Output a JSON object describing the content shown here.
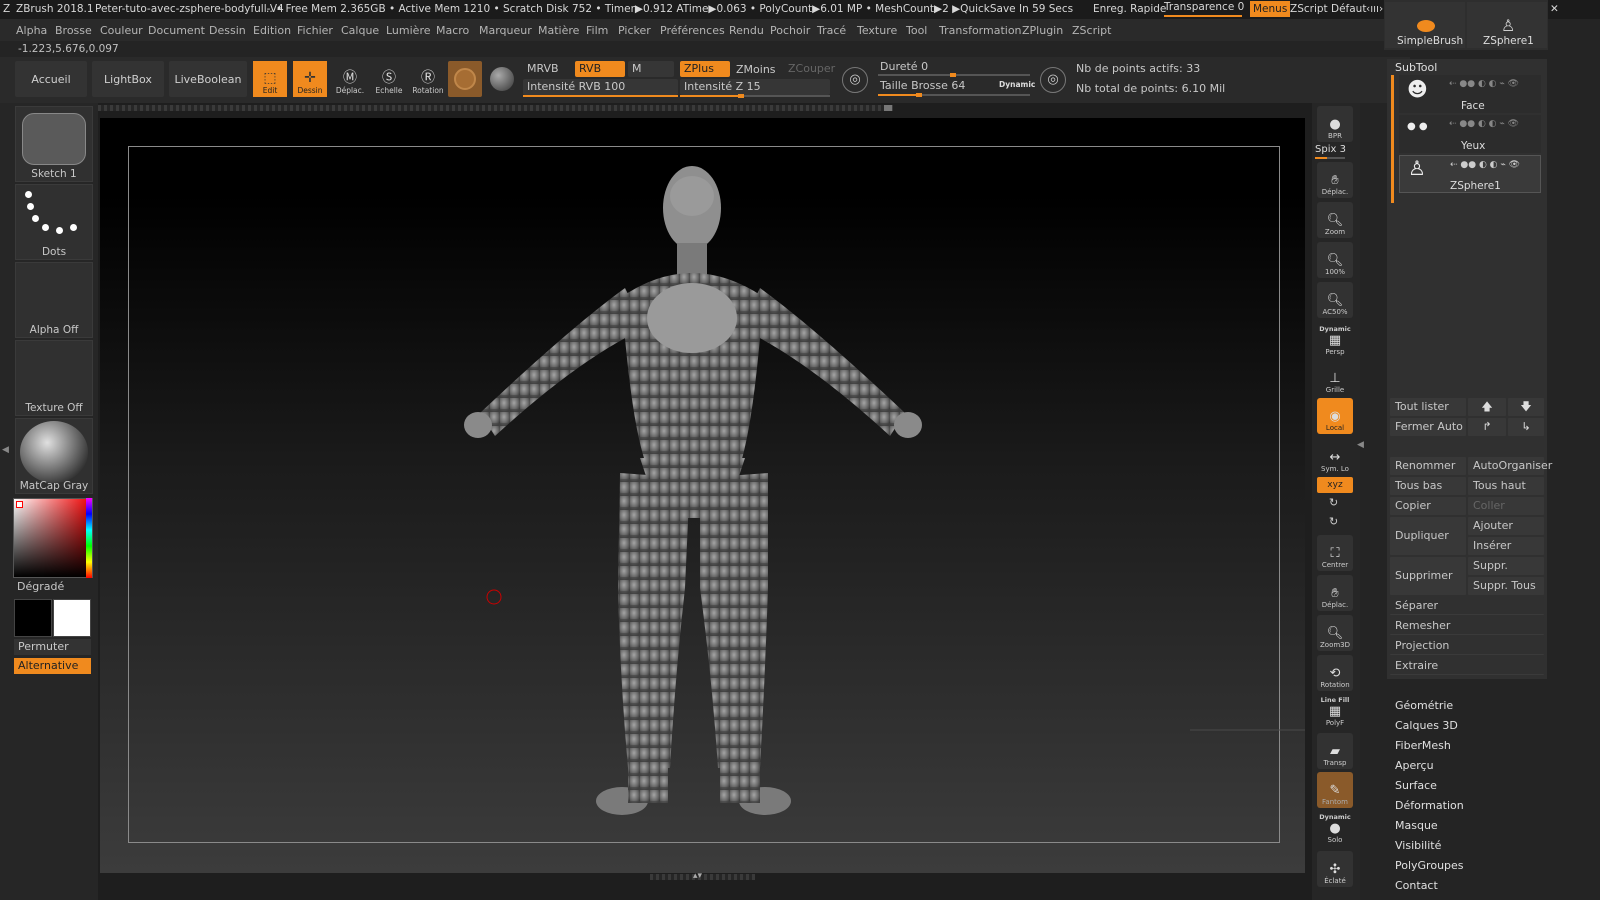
{
  "titlebar": {
    "app": "ZBrush 2018.1",
    "file": "Peter-tuto-avec-zsphere-bodyfull-V4",
    "stats": ".. • Free Mem 2.365GB • Active Mem 1210 • Scratch Disk 752 • Timer▶0.912 ATime▶0.063 • PolyCount▶6.01 MP • MeshCount▶2 ▶QuickSave In 59 Secs",
    "enreg": "Enreg. Rapide",
    "transparence": "Transparence 0",
    "menus": "Menus",
    "zscript": "ZScript Défaut"
  },
  "menu": [
    "Alpha",
    "Brosse",
    "Couleur",
    "Document",
    "Dessin",
    "Edition",
    "Fichier",
    "Calque",
    "Lumière",
    "Macro",
    "Marqueur",
    "Matière",
    "Film",
    "Picker",
    "Préférences",
    "Rendu",
    "Pochoir",
    "Tracé",
    "Texture",
    "Tool",
    "Transformation",
    "ZPlugin",
    "ZScript"
  ],
  "coords": "-1.223,5.676,0.097",
  "toolbar": {
    "accueil": "Accueil",
    "lightbox": "LightBox",
    "liveboolean": "LiveBoolean",
    "edit": "Edit",
    "dessin": "Dessin",
    "deplac": "Déplac.",
    "echelle": "Echelle",
    "rotation": "Rotation",
    "mrvb": "MRVB",
    "rvb": "RVB",
    "m": "M",
    "zplus": "ZPlus",
    "zmoins": "ZMoins",
    "zcouper": "ZCouper",
    "intensite_rvb": "Intensité RVB 100",
    "intensite_z": "Intensité Z 15",
    "durete": "Dureté 0",
    "taille": "Taille Brosse 64",
    "dynamic": "Dynamic",
    "points_actifs": "Nb de points actifs: 33",
    "points_total": "Nb total de points: 6.10 Mil"
  },
  "left": {
    "sketch": "Sketch 1",
    "dots": "Dots",
    "alpha": "Alpha Off",
    "texture": "Texture Off",
    "matcap": "MatCap Gray",
    "degrade": "Dégradé",
    "permuter": "Permuter",
    "alternative": "Alternative"
  },
  "shelf": {
    "bpr": "BPR",
    "spix": "Spix 3",
    "deplac": "Déplac.",
    "zoom": "Zoom",
    "zoom100": "100%",
    "ac50": "AC50%",
    "dynamic": "Dynamic",
    "persp": "Persp",
    "grille": "Grille",
    "local": "Local",
    "symlo": "Sym. Lo",
    "xyz": "xyz",
    "centrer": "Centrer",
    "deplac2": "Déplac.",
    "zoom3d": "Zoom3D",
    "rotation": "Rotation",
    "linefill": "Line Fill",
    "polyf": "PolyF",
    "transp": "Transp",
    "fantom": "Fantom",
    "dynamic2": "Dynamic",
    "solo": "Solo",
    "eclate": "Éclaté"
  },
  "topright": {
    "simplebrush": "SimpleBrush",
    "zsphere": "ZSphere1"
  },
  "subtool": {
    "title": "SubTool",
    "items": [
      "Face",
      "Yeux",
      "ZSphere1"
    ],
    "tout_lister": "Tout lister",
    "fermer_auto": "Fermer Auto",
    "renommer": "Renommer",
    "autoorganiser": "AutoOrganiser",
    "tous_bas": "Tous bas",
    "tous_haut": "Tous haut",
    "copier": "Copier",
    "coller": "Coller",
    "dupliquer": "Dupliquer",
    "ajouter": "Ajouter",
    "inserer": "Insérer",
    "supprimer": "Supprimer",
    "suppr_autres": "Suppr. Autres",
    "suppr_tous": "Suppr. Tous",
    "separer": "Séparer",
    "remesher": "Remesher",
    "projection": "Projection",
    "extraire": "Extraire"
  },
  "sections": [
    "Géométrie",
    "Calques 3D",
    "FiberMesh",
    "Aperçu",
    "Surface",
    "Déformation",
    "Masque",
    "Visibilité",
    "PolyGroupes",
    "Contact"
  ],
  "colors": {
    "accent": "#f08a1e",
    "background": "#242424"
  }
}
